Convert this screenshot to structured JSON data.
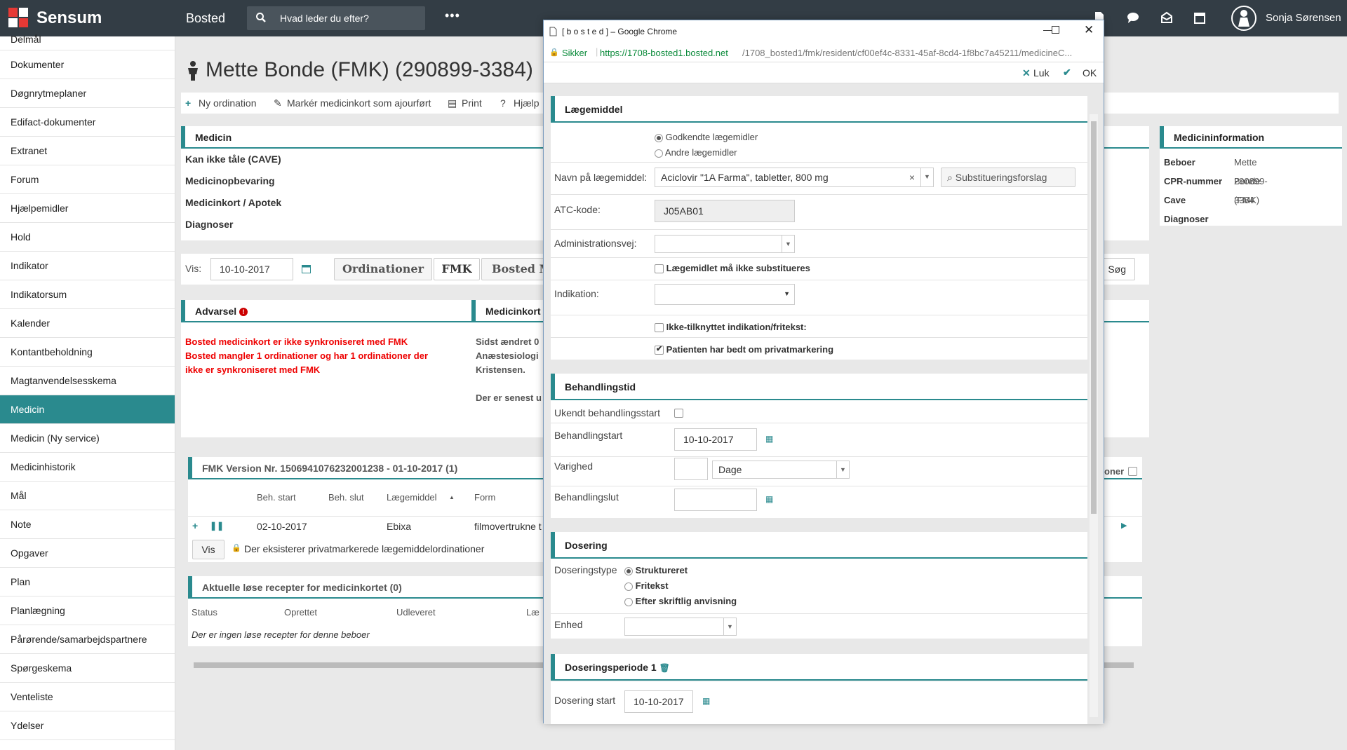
{
  "topbar": {
    "brand": "Sensum",
    "app": "Bosted",
    "search_placeholder": "Hvad leder du efter?",
    "more": "•••",
    "user": "Sonja Sørensen"
  },
  "sidebar": {
    "items": [
      "Delmål",
      "Dokumenter",
      "Døgnrytmeplaner",
      "Edifact-dokumenter",
      "Extranet",
      "Forum",
      "Hjælpemidler",
      "Hold",
      "Indikator",
      "Indikatorsum",
      "Kalender",
      "Kontantbeholdning",
      "Magtanvendelsesskema",
      "Medicin",
      "Medicin (Ny service)",
      "Medicinhistorik",
      "Mål",
      "Note",
      "Opgaver",
      "Plan",
      "Planlægning",
      "Pårørende/samarbejdspartnere",
      "Spørgeskema",
      "Venteliste",
      "Ydelser"
    ],
    "active": "Medicin"
  },
  "page": {
    "title": "Mette Bonde (FMK) (290899-3384)"
  },
  "toolbar": {
    "new": "Ny ordination",
    "mark": "Markér medicinkort som ajourført",
    "print": "Print",
    "help": "Hjælp"
  },
  "medicin": {
    "header": "Medicin",
    "rows": [
      "Kan ikke tåle (CAVE)",
      "Medicinopbevaring",
      "Medicinkort / Apotek",
      "Diagnoser"
    ]
  },
  "vis": {
    "label": "Vis:",
    "date": "10-10-2017",
    "tabs": [
      "Ordinationer",
      "FMK",
      "Bosted M"
    ],
    "search_fragment": "Søg"
  },
  "advarsel": {
    "header": "Advarsel",
    "lines": [
      "Bosted medicinkort er ikke synkroniseret med FMK",
      "Bosted mangler 1 ordinationer og har 1 ordinationer der",
      "ikke er synkroniseret med FMK"
    ]
  },
  "medicinkort": {
    "header": "Medicinkort",
    "lines": [
      "Sidst ændret 0",
      "Anæstesiologi",
      "Kristensen.",
      "Der er senest u"
    ]
  },
  "fmk": {
    "header": "FMK Version Nr. 1506941076232001238 - 01-10-2017 (1)",
    "columns": [
      "Beh. start",
      "Beh. slut",
      "Lægemiddel",
      "Form"
    ],
    "row": {
      "start": "02-10-2017",
      "drug": "Ebixa",
      "form": "filmovertrukne t"
    },
    "vis_btn": "Vis",
    "note": "Der eksisterer privatmarkerede lægemiddelordinationer",
    "right_fragment": "oner"
  },
  "recepter": {
    "header": "Aktuelle løse recepter for medicinkortet (0)",
    "columns": [
      "Status",
      "Oprettet",
      "Udleveret",
      "Læ"
    ],
    "empty": "Der er ingen løse recepter for denne beboer"
  },
  "info": {
    "header": "Medicininformation",
    "rows": [
      {
        "k": "Beboer",
        "v": "Mette Bonde (FMK)"
      },
      {
        "k": "CPR-nummer",
        "v": "290899-3384"
      },
      {
        "k": "Cave",
        "v": ""
      },
      {
        "k": "Diagnoser",
        "v": ""
      }
    ]
  },
  "dialog": {
    "title": "[ b o s t e d ] – Google Chrome",
    "secure": "Sikker",
    "url_host": "https://1708-bosted1.bosted.net",
    "url_path": "/1708_bosted1/fmk/resident/cf00ef4c-8331-45af-8cd4-1f8bc7a45211/medicineC...",
    "close": "Luk",
    "ok": "OK",
    "laegemiddel": {
      "header": "Lægemiddel",
      "radio1": "Godkendte lægemidler",
      "radio2": "Andre lægemidler",
      "name_label": "Navn på lægemiddel:",
      "name_value": "Aciclovir \"1A Farma\", tabletter, 800 mg",
      "subst_btn": "Substitueringsforslag",
      "atc_label": "ATC-kode:",
      "atc_value": "J05AB01",
      "admin_label": "Administrationsvej:",
      "no_subst": "Lægemidlet må ikke substitueres",
      "ind_label": "Indikation:",
      "ind_free": "Ikke-tilknyttet indikation/fritekst:",
      "privat": "Patienten har bedt om privatmarkering"
    },
    "behandling": {
      "header": "Behandlingstid",
      "unknown": "Ukendt behandlingsstart",
      "start_label": "Behandlingstart",
      "start_value": "10-10-2017",
      "varighed_label": "Varighed",
      "varighed_unit": "Dage",
      "slut_label": "Behandlingslut"
    },
    "dosering": {
      "header": "Dosering",
      "type_label": "Doseringstype",
      "opt1": "Struktureret",
      "opt2": "Fritekst",
      "opt3": "Efter skriftlig anvisning",
      "enhed_label": "Enhed"
    },
    "periode": {
      "header": "Doseringsperiode 1",
      "start_label": "Dosering start",
      "start_value": "10-10-2017"
    }
  }
}
